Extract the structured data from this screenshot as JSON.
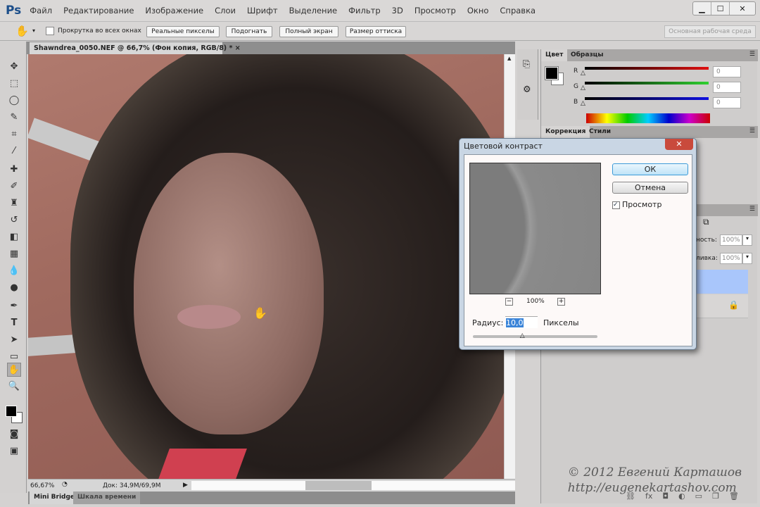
{
  "app": {
    "logo": "Ps"
  },
  "menu": [
    "Файл",
    "Редактирование",
    "Изображение",
    "Слои",
    "Шрифт",
    "Выделение",
    "Фильтр",
    "3D",
    "Просмотр",
    "Окно",
    "Справка"
  ],
  "window_controls": {
    "minimize": "▁",
    "maximize": "☐",
    "close": "✕"
  },
  "options": {
    "scroll_all": "Прокрутка во всех окнах",
    "actual_pixels": "Реальные пикселы",
    "fit": "Подогнать",
    "full_screen": "Полный экран",
    "print_size": "Размер оттиска",
    "workspace": "Основная рабочая среда"
  },
  "document": {
    "tab_title": "Shawndrea_0050.NEF @ 66,7% (Фон копия, RGB/8) *",
    "close": "×"
  },
  "status": {
    "zoom": "66,67%",
    "doc": "Док: 34,9M/69,9M"
  },
  "bottom_tabs": [
    "Mini Bridge",
    "Шкала времени"
  ],
  "color_panel": {
    "tabs": [
      "Цвет",
      "Образцы"
    ],
    "channels": [
      {
        "label": "R",
        "value": "0",
        "color": "#e01010"
      },
      {
        "label": "G",
        "value": "0",
        "color": "#30d030"
      },
      {
        "label": "B",
        "value": "0",
        "color": "#1010e0"
      }
    ]
  },
  "correction_panel": {
    "tabs": [
      "Коррекция",
      "Стили"
    ]
  },
  "layers_panel": {
    "opacity_label": "ность:",
    "opacity": "100%",
    "fill_label": "ливка:",
    "fill": "100%"
  },
  "dialog": {
    "title": "Цветовой контраст",
    "ok": "ОК",
    "cancel": "Отмена",
    "preview_label": "Просмотр",
    "preview_checked": true,
    "zoom": "100%",
    "zoom_out": "−",
    "zoom_in": "+",
    "radius_label": "Радиус:",
    "radius_value": "10,0",
    "units": "Пикселы",
    "radius_slider_fraction": 0.4
  },
  "watermark": {
    "line1": "© 2012 Евгений Карташов",
    "line2": "http://eugenekartashov.com"
  }
}
